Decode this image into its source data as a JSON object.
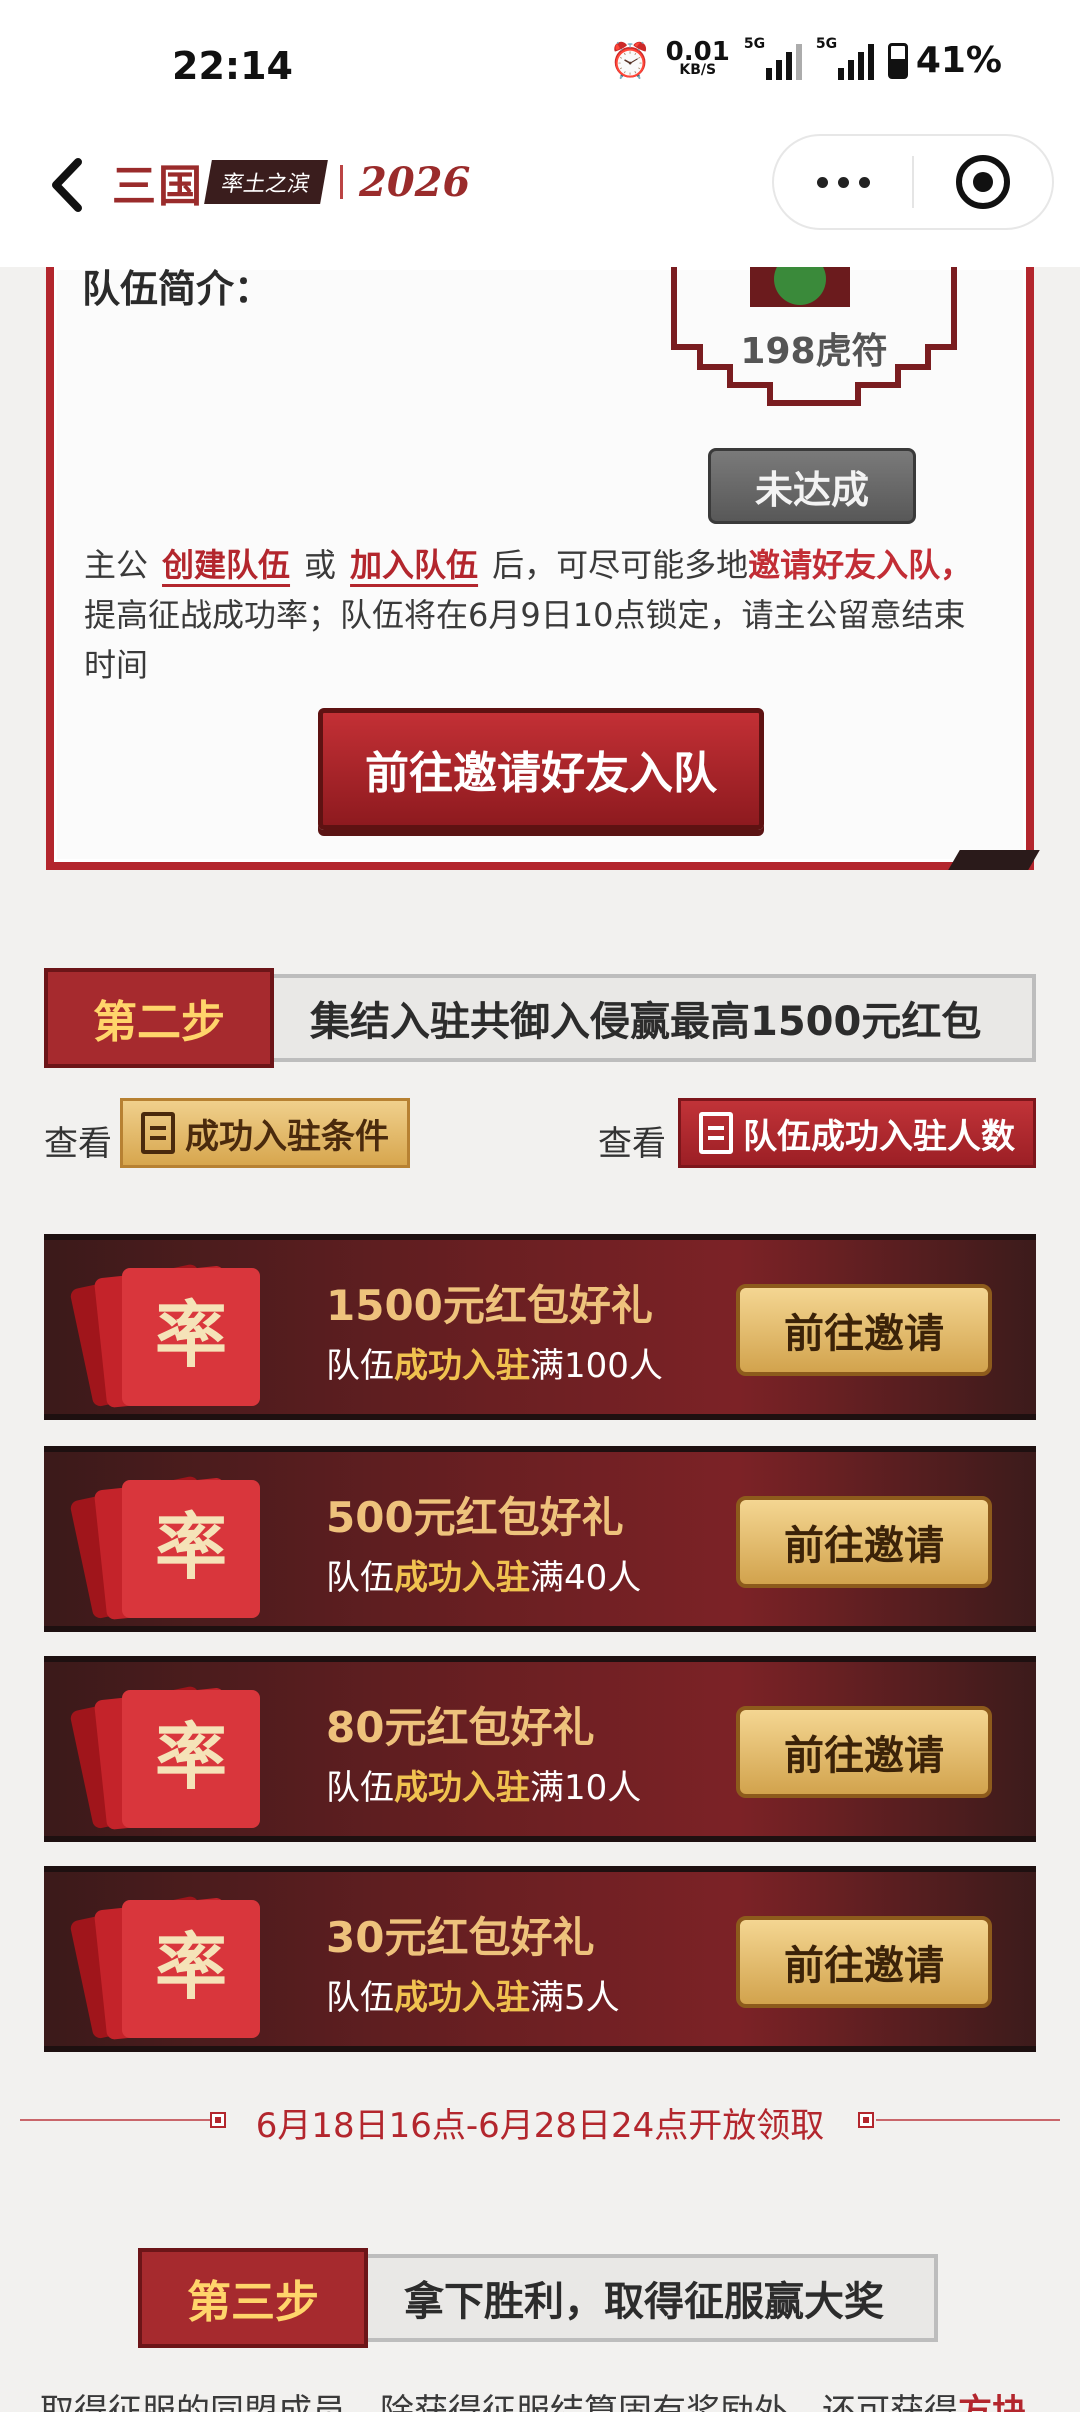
{
  "status_bar": {
    "time": "22:14",
    "net_speed_value": "0.01",
    "net_speed_unit": "KB/S",
    "signal1_label": "5G",
    "signal2_label": "5G",
    "battery": "41%"
  },
  "header": {
    "logo_main": "三国",
    "logo_sub": "率土之滨",
    "logo_year": "2026"
  },
  "intro": {
    "title": "队伍简介：",
    "reward": "198虎符",
    "status": "未达成",
    "desc_prefix": "主公",
    "create_team": "创建队伍",
    "or": "或",
    "join_team": "加入队伍",
    "desc_mid": "后，可尽可能多地",
    "desc_highlight": "邀请好友入队，",
    "desc_suffix": "提高征战成功率；队伍将在6月9日10点锁定，请主公留意结束时间",
    "invite_button": "前往邀请好友入队"
  },
  "step2": {
    "tag": "第二步",
    "text": "集结入驻共御入侵赢最高1500元红包"
  },
  "view_row": {
    "left_label": "查看",
    "left_button": "成功入驻条件",
    "right_label": "查看",
    "right_button": "队伍成功入驻人数"
  },
  "packets": [
    {
      "title": "1500元红包好礼",
      "cond_prefix": "队伍",
      "cond_hl": "成功入驻",
      "cond_suffix": "满100人",
      "button": "前往邀请"
    },
    {
      "title": "500元红包好礼",
      "cond_prefix": "队伍",
      "cond_hl": "成功入驻",
      "cond_suffix": "满40人",
      "button": "前往邀请"
    },
    {
      "title": "80元红包好礼",
      "cond_prefix": "队伍",
      "cond_hl": "成功入驻",
      "cond_suffix": "满10人",
      "button": "前往邀请"
    },
    {
      "title": "30元红包好礼",
      "cond_prefix": "队伍",
      "cond_hl": "成功入驻",
      "cond_suffix": "满5人",
      "button": "前往邀请"
    }
  ],
  "packet_icon_char": "率",
  "claim_time": "6月18日16点-6月28日24点开放领取",
  "step3": {
    "tag": "第三步",
    "text": "拿下胜利，取得征服赢大奖"
  },
  "bottom": {
    "text": "取得征服的同盟成员，除获得征服结算固有奖励外，还可获得",
    "highlight": "方块"
  },
  "colors": {
    "accent_red": "#b3262d",
    "gold": "#eec27c",
    "background": "#f2f1ef"
  }
}
